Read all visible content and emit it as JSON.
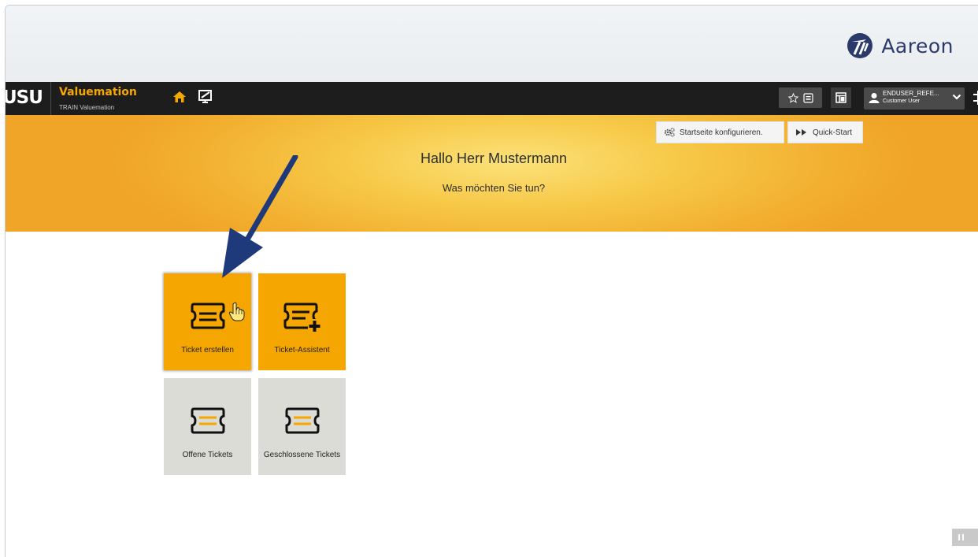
{
  "brand": {
    "company": "Aareon"
  },
  "topbar": {
    "logo": "USU",
    "app_name": "Valuemation",
    "app_subtitle": "TRAIN Valuemation",
    "user": {
      "name": "ENDUSER_REFE...",
      "role": "Customer User"
    }
  },
  "hero": {
    "config_button": "Startseite konfigurieren.",
    "quickstart_button": "Quick-Start",
    "greeting": "Hallo Herr Mustermann",
    "question": "Was möchten Sie tun?"
  },
  "tiles": [
    {
      "label": "Ticket erstellen",
      "color": "#f6a600"
    },
    {
      "label": "Ticket-Assistent",
      "color": "#f6a600"
    },
    {
      "label": "Offene Tickets",
      "color": "#dcdcd7"
    },
    {
      "label": "Geschlossene Tickets",
      "color": "#dcdcd7"
    }
  ],
  "colors": {
    "accent": "#f6a600",
    "topbar": "#1d1d1d",
    "annotation_arrow": "#1f3a7a"
  }
}
